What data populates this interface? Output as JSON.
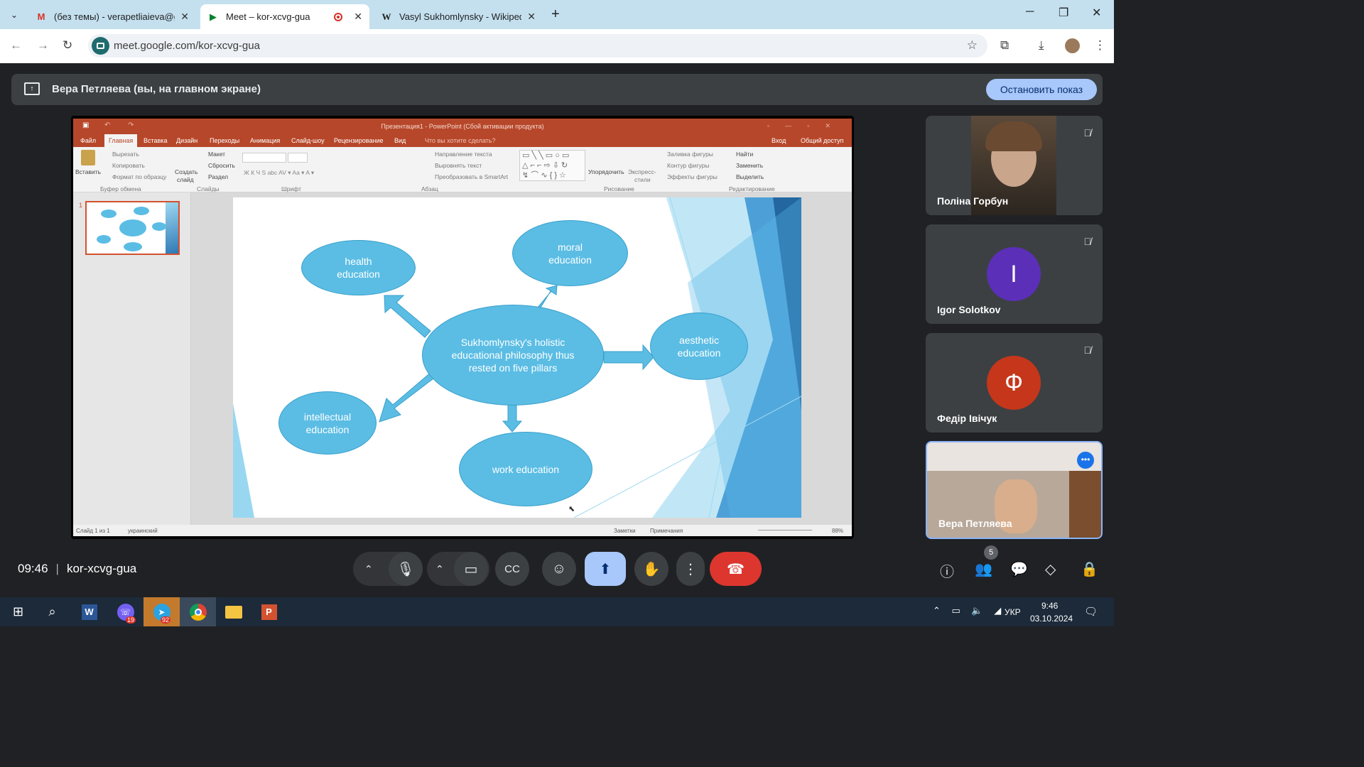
{
  "browser": {
    "tabs": [
      {
        "title": "(без темы) - verapetliaieva@gm",
        "icon": "gmail-icon"
      },
      {
        "title": "Meet – kor-xcvg-gua",
        "icon": "meet-icon"
      },
      {
        "title": "Vasyl Sukhomlynsky - Wikipedia",
        "icon": "wikipedia-icon"
      }
    ],
    "url": "meet.google.com/kor-xcvg-gua"
  },
  "presentation_bar": {
    "label": "Вера Петляева (вы, на главном экране)",
    "stop_button": "Остановить показ"
  },
  "powerpoint": {
    "title": "Презентация1 - PowerPoint (Сбой активации продукта)",
    "tabs": [
      "Файл",
      "Главная",
      "Вставка",
      "Дизайн",
      "Переходы",
      "Анимация",
      "Слайд-шоу",
      "Рецензирование",
      "Вид"
    ],
    "tell_me": "Что вы хотите сделать?",
    "sign_in": "Вход",
    "share": "Общий доступ",
    "ribbon": {
      "paste": "Вставить",
      "cut": "Вырезать",
      "copy": "Копировать",
      "format_painter": "Формат по образцу",
      "clipboard_group": "Буфер обмена",
      "new_slide_1": "Создать",
      "new_slide_2": "слайд",
      "layout": "Макет",
      "reset": "Сбросить",
      "section": "Раздел",
      "slides_group": "Слайды",
      "font_group": "Шрифт",
      "text_direction": "Направление текста",
      "align_text": "Выровнять текст",
      "smartart": "Преобразовать в SmartArt",
      "paragraph_group": "Абзац",
      "arrange": "Упорядочить",
      "quick_styles_1": "Экспресс-",
      "quick_styles_2": "стили",
      "shape_fill": "Заливка фигуры",
      "shape_outline": "Контур фигуры",
      "shape_effects": "Эффекты фигуры",
      "drawing_group": "Рисование",
      "find": "Найти",
      "replace": "Заменить",
      "select": "Выделить",
      "editing_group": "Редактирование"
    },
    "thumb_number": "1",
    "slide": {
      "center": "Sukhomlynsky's holistic educational philosophy thus rested on five pillars",
      "health": "health education",
      "moral": "moral education",
      "aesthetic": "aesthetic education",
      "intellectual": "intellectual education",
      "work": "work education"
    },
    "status": {
      "slide_count": "Слайд 1 из 1",
      "language": "украинский",
      "notes": "Заметки",
      "comments": "Примечания",
      "zoom": "88%"
    }
  },
  "participants": [
    {
      "name": "Поліна Горбун",
      "muted": true
    },
    {
      "name": "Igor Solotkov",
      "initial": "I",
      "color": "#5b2fb8",
      "muted": true
    },
    {
      "name": "Федір Івічук",
      "initial": "Ф",
      "color": "#c5361b",
      "muted": true
    },
    {
      "name": "Вера Петляева"
    }
  ],
  "meeting": {
    "time": "09:46",
    "code": "kor-xcvg-gua",
    "participant_count": "5"
  },
  "taskbar": {
    "viber_badge": "19",
    "telegram_badge": "92",
    "lang": "УКР",
    "time": "9:46",
    "date": "03.10.2024"
  }
}
